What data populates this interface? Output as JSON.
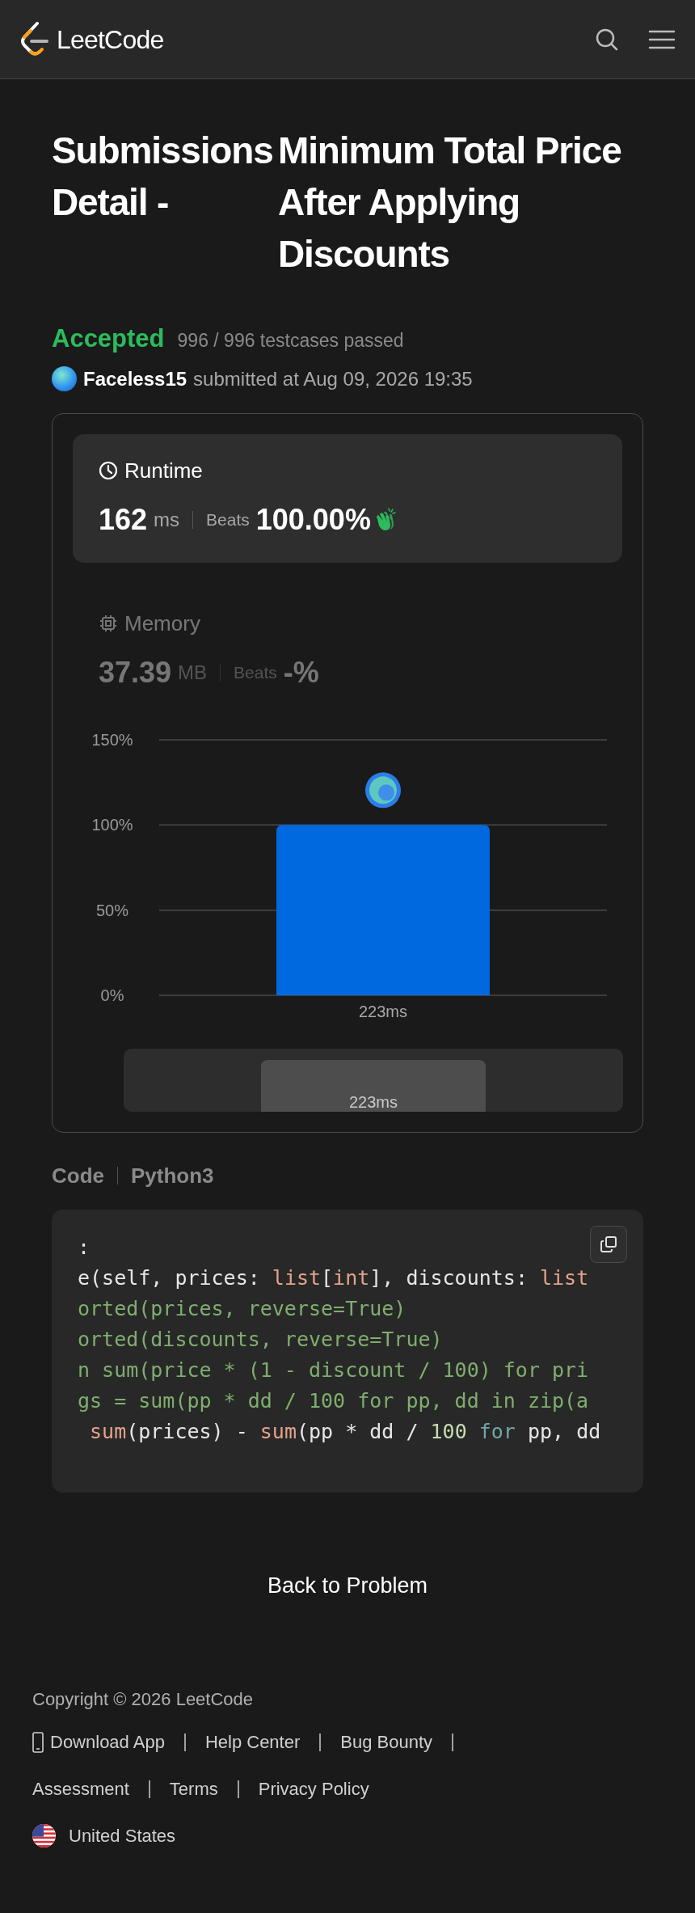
{
  "header": {
    "logo_text": "LeetCode"
  },
  "title": {
    "prefix": "Submissions Detail -",
    "problem": "Minimum Total Price After Applying Discounts"
  },
  "result": {
    "status": "Accepted",
    "testcases": "996 / 996 testcases passed",
    "user": "Faceless15",
    "submitted": "submitted at Aug 09, 2026 19:35"
  },
  "stats": [
    {
      "kind": "runtime",
      "label": "Runtime",
      "value": "162",
      "unit": "ms",
      "beats_label": "Beats",
      "beats": "100.00%",
      "selected": true
    },
    {
      "kind": "memory",
      "label": "Memory",
      "value": "37.39",
      "unit": "MB",
      "beats_label": "Beats",
      "beats": "-%",
      "selected": false
    }
  ],
  "chart_data": {
    "type": "bar",
    "categories": [
      "223ms"
    ],
    "values": [
      100
    ],
    "ylim": [
      0,
      150
    ],
    "yticks": [
      {
        "value": 0,
        "label": "0%"
      },
      {
        "value": 50,
        "label": "50%"
      },
      {
        "value": 100,
        "label": "100%"
      },
      {
        "value": 150,
        "label": "150%"
      }
    ]
  },
  "navigator": {
    "label": "223ms"
  },
  "code": {
    "label": "Code",
    "language": "Python3",
    "lines": [
      [
        {
          "kind": "plain",
          "text": ":"
        }
      ],
      [
        {
          "kind": "plain",
          "text": "e(self, prices: "
        },
        {
          "kind": "builtin",
          "text": "list"
        },
        {
          "kind": "plain",
          "text": "["
        },
        {
          "kind": "builtin",
          "text": "int"
        },
        {
          "kind": "plain",
          "text": "], discounts: "
        },
        {
          "kind": "builtin",
          "text": "list"
        }
      ],
      [
        {
          "kind": "faded",
          "text": "orted(prices, reverse=True)"
        }
      ],
      [
        {
          "kind": "faded",
          "text": "orted(discounts, reverse=True)"
        }
      ],
      [
        {
          "kind": "faded",
          "text": "n sum(price * (1 - discount / 100) for pri"
        }
      ],
      [
        {
          "kind": "faded",
          "text": "gs = sum(pp * dd / 100 for pp, dd in zip(a"
        }
      ],
      [
        {
          "kind": "builtin",
          "text": " sum"
        },
        {
          "kind": "plain",
          "text": "(prices) - "
        },
        {
          "kind": "builtin",
          "text": "sum"
        },
        {
          "kind": "plain",
          "text": "(pp * dd / "
        },
        {
          "kind": "number",
          "text": "100 "
        },
        {
          "kind": "keyword",
          "text": "for"
        },
        {
          "kind": "plain",
          "text": " pp, dd"
        }
      ]
    ]
  },
  "back_link": "Back to Problem",
  "footer": {
    "copyright": "Copyright © 2026 LeetCode",
    "link_rows": [
      [
        {
          "kind": "app",
          "label": "Download App"
        },
        {
          "kind": "link",
          "label": "Help Center"
        },
        {
          "kind": "link",
          "label": "Bug Bounty"
        }
      ],
      [
        {
          "kind": "link",
          "label": "Assessment"
        },
        {
          "kind": "link",
          "label": "Terms"
        },
        {
          "kind": "link",
          "label": "Privacy Policy"
        }
      ]
    ],
    "region": "United States"
  }
}
